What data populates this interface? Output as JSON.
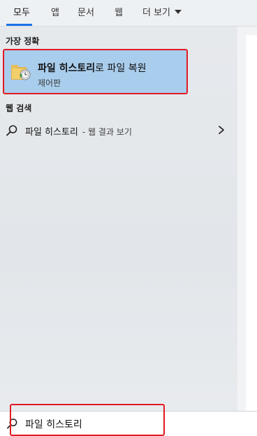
{
  "tabs": [
    {
      "label": "모두",
      "active": true
    },
    {
      "label": "앱",
      "active": false
    },
    {
      "label": "문서",
      "active": false
    },
    {
      "label": "웹",
      "active": false
    }
  ],
  "more_label": "더 보기",
  "best_match": {
    "header": "가장 정확",
    "title_bold": "파일 히스토리",
    "title_rest": "로 파일 복원",
    "subtitle": "제어판",
    "icon": "file-history-folder-icon"
  },
  "web_search": {
    "header": "웹 검색",
    "query": "파일 히스토리",
    "suffix": "- 웹 결과 보기",
    "icon": "search-icon"
  },
  "search_box": {
    "value": "파일 히스토리",
    "icon": "search-icon"
  },
  "colors": {
    "highlight": "#e01b24",
    "selected_bg": "#a9cdec",
    "active_tab_accent": "#1a73e8"
  }
}
